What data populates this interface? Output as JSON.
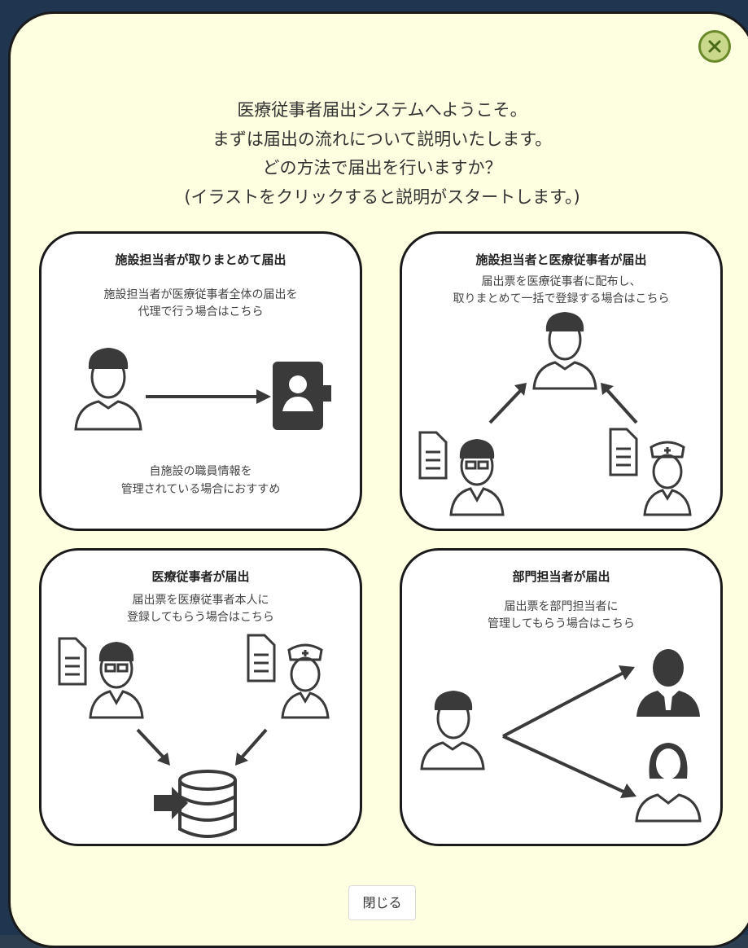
{
  "modal": {
    "intro_lines": [
      "医療従事者届出システムへようこそ。",
      "まずは届出の流れについて説明いたします。",
      "どの方法で届出を行いますか？",
      "(イラストをクリックすると説明がスタートします。)"
    ],
    "close_button_label": "閉じる"
  },
  "cards": [
    {
      "title": "施設担当者が取りまとめて届出",
      "desc": [
        "施設担当者が医療従事者全体の届出を",
        "代理で行う場合はこちら"
      ],
      "note": [
        "自施設の職員情報を",
        "管理されている場合におすすめ"
      ]
    },
    {
      "title": "施設担当者と医療従事者が届出",
      "desc": [
        "届出票を医療従事者に配布し、",
        "取りまとめて一括で登録する場合はこちら"
      ]
    },
    {
      "title": "医療従事者が届出",
      "desc": [
        "届出票を医療従事者本人に",
        "登録してもらう場合はこちら"
      ]
    },
    {
      "title": "部門担当者が届出",
      "desc": [
        "届出票を部門担当者に",
        "管理してもらう場合はこちら"
      ]
    }
  ],
  "colors": {
    "modal_bg": "#fefee0",
    "close_icon_bg": "#c9d88a",
    "icon_dark": "#3a3a3a"
  }
}
